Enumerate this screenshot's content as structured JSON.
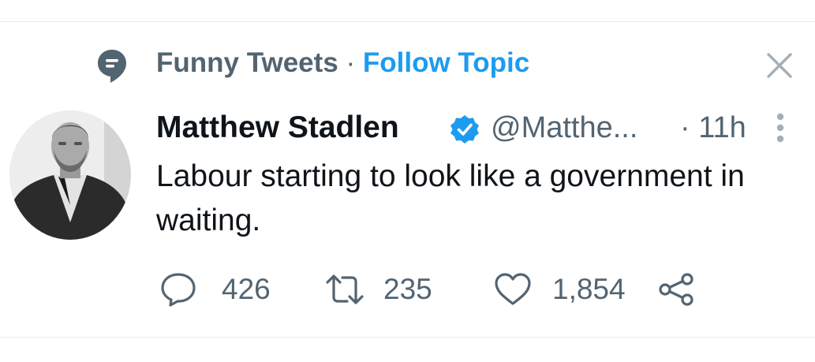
{
  "topic": {
    "name": "Funny Tweets",
    "separator": "·",
    "follow_label": "Follow Topic"
  },
  "tweet": {
    "author_name": "Matthew Stadlen",
    "handle": "@Matthe...",
    "time": "· 11h",
    "text": "Labour starting to look like a government in waiting.",
    "verified": true
  },
  "actions": {
    "replies": "426",
    "retweets": "235",
    "likes": "1,854"
  },
  "colors": {
    "accent": "#1d9bf0",
    "muted": "#536471",
    "text": "#0f1419",
    "divider": "#e7e9ea"
  },
  "icons": [
    "topic-icon",
    "close-icon",
    "verified-icon",
    "more-icon",
    "reply-icon",
    "retweet-icon",
    "like-icon",
    "share-icon"
  ]
}
